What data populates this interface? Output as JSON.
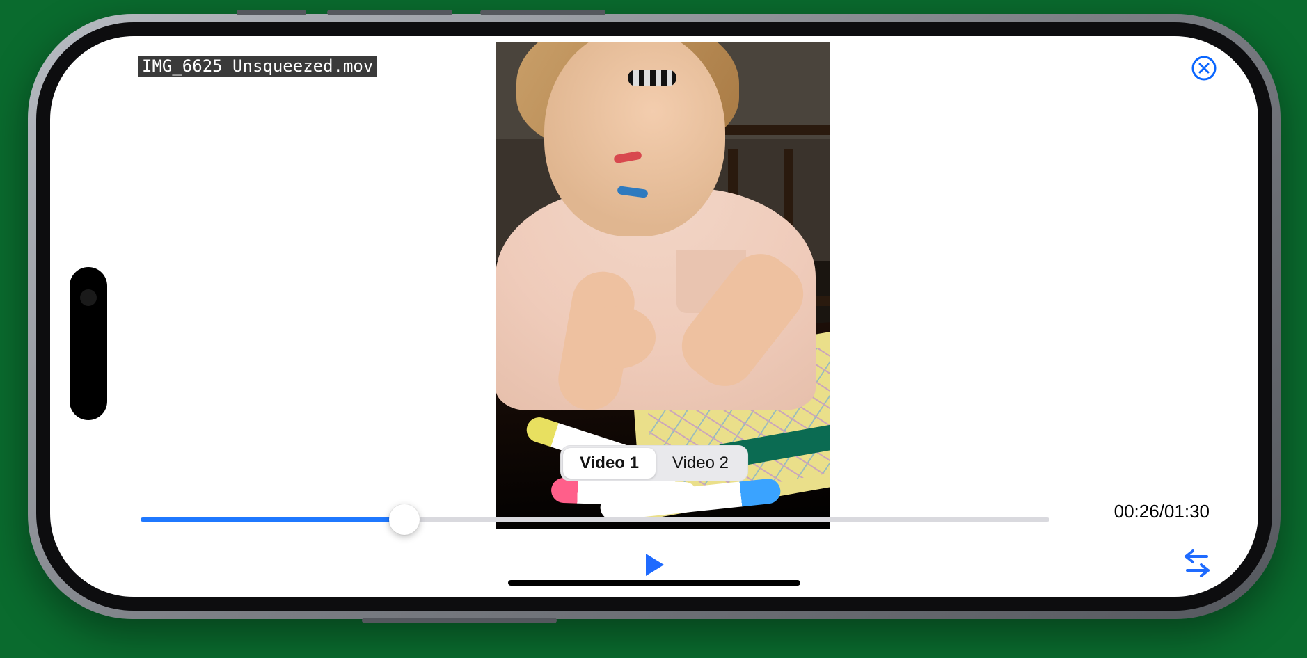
{
  "filename": "IMG_6625 Unsqueezed.mov",
  "close_label": "X",
  "segmented": {
    "options": [
      "Video 1",
      "Video 2"
    ],
    "selected_index": 0
  },
  "playback": {
    "current_time": "00:26",
    "duration": "01:30",
    "progress_pct": 29,
    "is_playing": false
  },
  "time_display": "00:26/01:30",
  "icons": {
    "close": "close-circle",
    "play": "play",
    "swap": "swap-horizontal"
  },
  "colors": {
    "accent": "#1f6bff",
    "track": "#d9d9de"
  }
}
